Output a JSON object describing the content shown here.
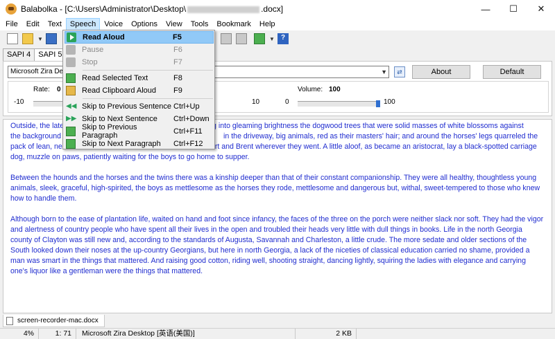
{
  "window": {
    "title_prefix": "Balabolka - [C:\\Users\\Administrator\\Desktop\\",
    "title_suffix": ".docx]",
    "minimize": "—",
    "maximize": "☐",
    "close": "✕"
  },
  "menu": {
    "items": [
      "File",
      "Edit",
      "Text",
      "Speech",
      "Voice",
      "Options",
      "View",
      "Tools",
      "Bookmark",
      "Help"
    ]
  },
  "speech_menu": {
    "items": [
      {
        "label": "Read Aloud",
        "shortcut": "F5"
      },
      {
        "label": "Pause",
        "shortcut": "F6"
      },
      {
        "label": "Stop",
        "shortcut": "F7"
      },
      {
        "label": "Read Selected Text",
        "shortcut": "F8"
      },
      {
        "label": "Read Clipboard Aloud",
        "shortcut": "F9"
      },
      {
        "label": "Skip to Previous Sentence",
        "shortcut": "Ctrl+Up"
      },
      {
        "label": "Skip to Next Sentence",
        "shortcut": "Ctrl+Down"
      },
      {
        "label": "Skip to Previous Paragraph",
        "shortcut": "Ctrl+F11"
      },
      {
        "label": "Skip to Next Paragraph",
        "shortcut": "Ctrl+F12"
      }
    ]
  },
  "tabs": {
    "sapi4": "SAPI 4",
    "sapi5": "SAPI 5",
    "third": "M"
  },
  "voice_panel": {
    "voice": "Microsoft Zira Desk",
    "about": "About",
    "default": "Default",
    "rate_label": "Rate:",
    "rate_value": "0",
    "rate_min": "-10",
    "pitch_max": "10",
    "volume_min": "0",
    "volume_label": "Volume:",
    "volume_value": "100",
    "volume_max": "100",
    "volume_level": 1.0
  },
  "text": {
    "p1_a": "Outside, the late",
    "p1_b": "ng into gleaming brightness the dogwood trees that were solid masses of white blossoms against",
    "p1_c": "the background",
    "p1_d": "in the driveway, big animals, red as their masters' hair; and around the horses' legs quarreled the",
    "p1_e": "pack of lean, ne",
    "p1_f": "rt and Brent wherever they went. A little aloof, as became an aristocrat, lay a black-spotted carriage",
    "p1_g": "dog, muzzle on paws, patiently waiting for the boys to go home to supper.",
    "p2": "Between the hounds and the horses and the twins there was a kinship deeper than that of their constant companionship. They were all healthy, thoughtless young animals, sleek, graceful, high-spirited, the boys as mettlesome as the horses they rode, mettlesome and dangerous but, withal, sweet-tempered to those who knew how to handle them.",
    "p3": "Although born to the ease of plantation life, waited on hand and foot since infancy, the faces of the three on the porch were neither slack nor soft. They had the vigor and alertness of country people who have spent all their lives in the open and troubled their heads very little with dull things in books. Life in the north Georgia county of Clayton was still new and, according to the standards of Augusta, Savannah and Charleston, a little crude. The more sedate and older sections of the South looked down their noses at the up-country Georgians, but here in north Georgia, a lack of the niceties of classical education carried no shame, provided a man was smart in the things that mattered. And raising good cotton, riding well, shooting straight, dancing lightly, squiring the ladies with elegance and carrying one's liquor like a gentleman were the things that mattered."
  },
  "doc_tab": {
    "name": "screen-recorder-mac.docx"
  },
  "status": {
    "zoom": "4%",
    "position": "1:  71",
    "voice": "Microsoft Zira Desktop [英语(美国)]",
    "size": "2 KB"
  }
}
